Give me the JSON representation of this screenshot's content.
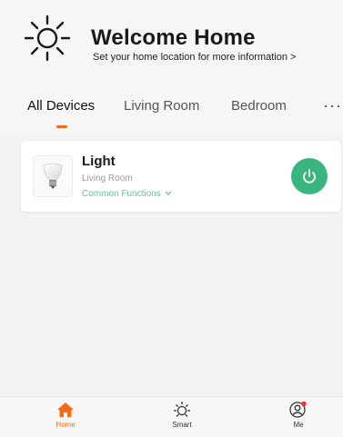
{
  "header": {
    "title": "Welcome Home",
    "subtitle": "Set your home location for more information >"
  },
  "tabs": [
    {
      "label": "All Devices",
      "active": true
    },
    {
      "label": "Living Room",
      "active": false
    },
    {
      "label": "Bedroom",
      "active": false
    }
  ],
  "more_label": "···",
  "device": {
    "name": "Light",
    "room": "Living Room",
    "functions_label": "Common Functions",
    "power_color": "#3bb57f"
  },
  "bottom_nav": [
    {
      "label": "Home",
      "icon": "home-icon",
      "active": true
    },
    {
      "label": "Smart",
      "icon": "sun-icon",
      "active": false
    },
    {
      "label": "Me",
      "icon": "user-icon",
      "active": false
    }
  ],
  "colors": {
    "accent": "#f26b1d",
    "green": "#3bb57f",
    "notification_dot": "#e53935"
  }
}
